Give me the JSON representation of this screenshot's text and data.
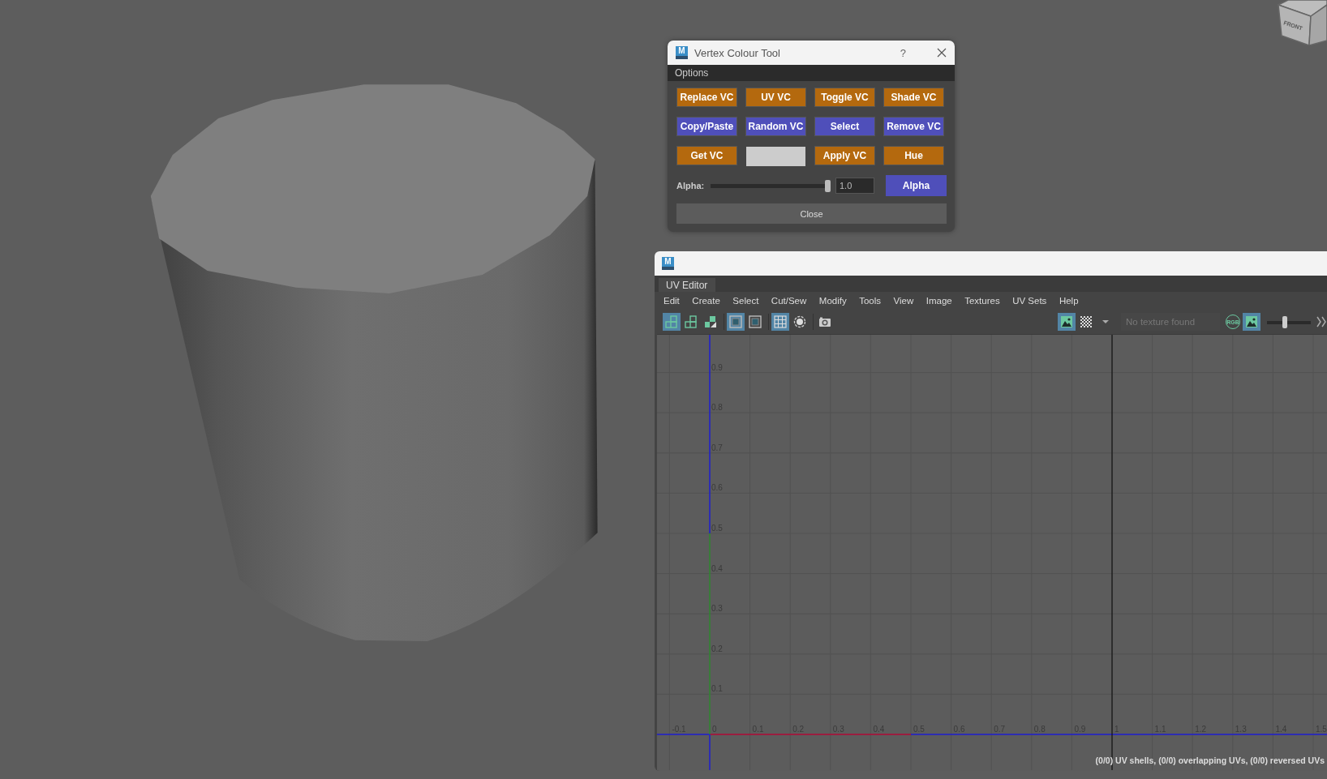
{
  "view_cube": {
    "label": "FRONT"
  },
  "dialog": {
    "app_icon": "M",
    "title": "Vertex Colour Tool",
    "help": "?",
    "menu": [
      "Options"
    ],
    "buttons": [
      {
        "kind": "button",
        "label": "Replace VC",
        "color": "#b4690e"
      },
      {
        "kind": "button",
        "label": "UV VC",
        "color": "#b4690e"
      },
      {
        "kind": "button",
        "label": "Toggle VC",
        "color": "#b4690e"
      },
      {
        "kind": "button",
        "label": "Shade VC",
        "color": "#b4690e"
      },
      {
        "kind": "button",
        "label": "Copy/Paste",
        "color": "#4f4fba"
      },
      {
        "kind": "button",
        "label": "Random VC",
        "color": "#4f4fba"
      },
      {
        "kind": "button",
        "label": "Select",
        "color": "#4f4fba"
      },
      {
        "kind": "button",
        "label": "Remove VC",
        "color": "#4f4fba"
      },
      {
        "kind": "button",
        "label": "Get VC",
        "color": "#b4690e"
      },
      {
        "kind": "swatch",
        "color": "#cccccc"
      },
      {
        "kind": "button",
        "label": "Apply VC",
        "color": "#b4690e"
      },
      {
        "kind": "button",
        "label": "Hue",
        "color": "#b4690e"
      }
    ],
    "alpha": {
      "label": "Alpha:",
      "level": 1.0,
      "value": "1.0",
      "button": "Alpha"
    },
    "close_button": "Close"
  },
  "uv_editor": {
    "app_icon": "M",
    "tab": "UV Editor",
    "menus": [
      "Edit",
      "Create",
      "Select",
      "Cut/Sew",
      "Modify",
      "Tools",
      "View",
      "Image",
      "Textures",
      "UV Sets",
      "Help"
    ],
    "toolbar_left": [
      {
        "kind": "shell",
        "selected": true
      },
      {
        "kind": "shell",
        "selected": false
      },
      {
        "kind": "shell-half",
        "selected": false
      },
      {
        "kind": "sep"
      },
      {
        "kind": "frame",
        "selected": true
      },
      {
        "kind": "frame",
        "selected": false
      },
      {
        "kind": "sep"
      },
      {
        "kind": "grid",
        "selected": true
      },
      {
        "kind": "ring",
        "selected": false
      },
      {
        "kind": "sep"
      },
      {
        "kind": "camera",
        "selected": false
      }
    ],
    "toolbar_right": [
      {
        "kind": "image",
        "selected": true
      },
      {
        "kind": "checker",
        "selected": false
      },
      {
        "kind": "caret",
        "selected": false
      },
      {
        "kind": "texture-field",
        "placeholder": "No texture found"
      },
      {
        "kind": "rgb",
        "label": "RGB",
        "selected": false
      },
      {
        "kind": "image",
        "selected": true
      },
      {
        "kind": "slider",
        "level": 0.4
      },
      {
        "kind": "arrows"
      }
    ],
    "u_labels": [
      "-0.1",
      "0",
      "0.1",
      "0.2",
      "0.3",
      "0.4",
      "0.5",
      "0.6",
      "0.7",
      "0.8",
      "0.9",
      "1",
      "1.1",
      "1.2",
      "1.3",
      "1.4",
      "1.5"
    ],
    "v_labels": [
      "0.9",
      "0.8",
      "0.7",
      "0.6",
      "0.5",
      "0.4",
      "0.3",
      "0.2",
      "0.1"
    ],
    "status": "(0/0) UV shells, (0/0) overlapping UVs, (0/0) reversed UVs"
  }
}
